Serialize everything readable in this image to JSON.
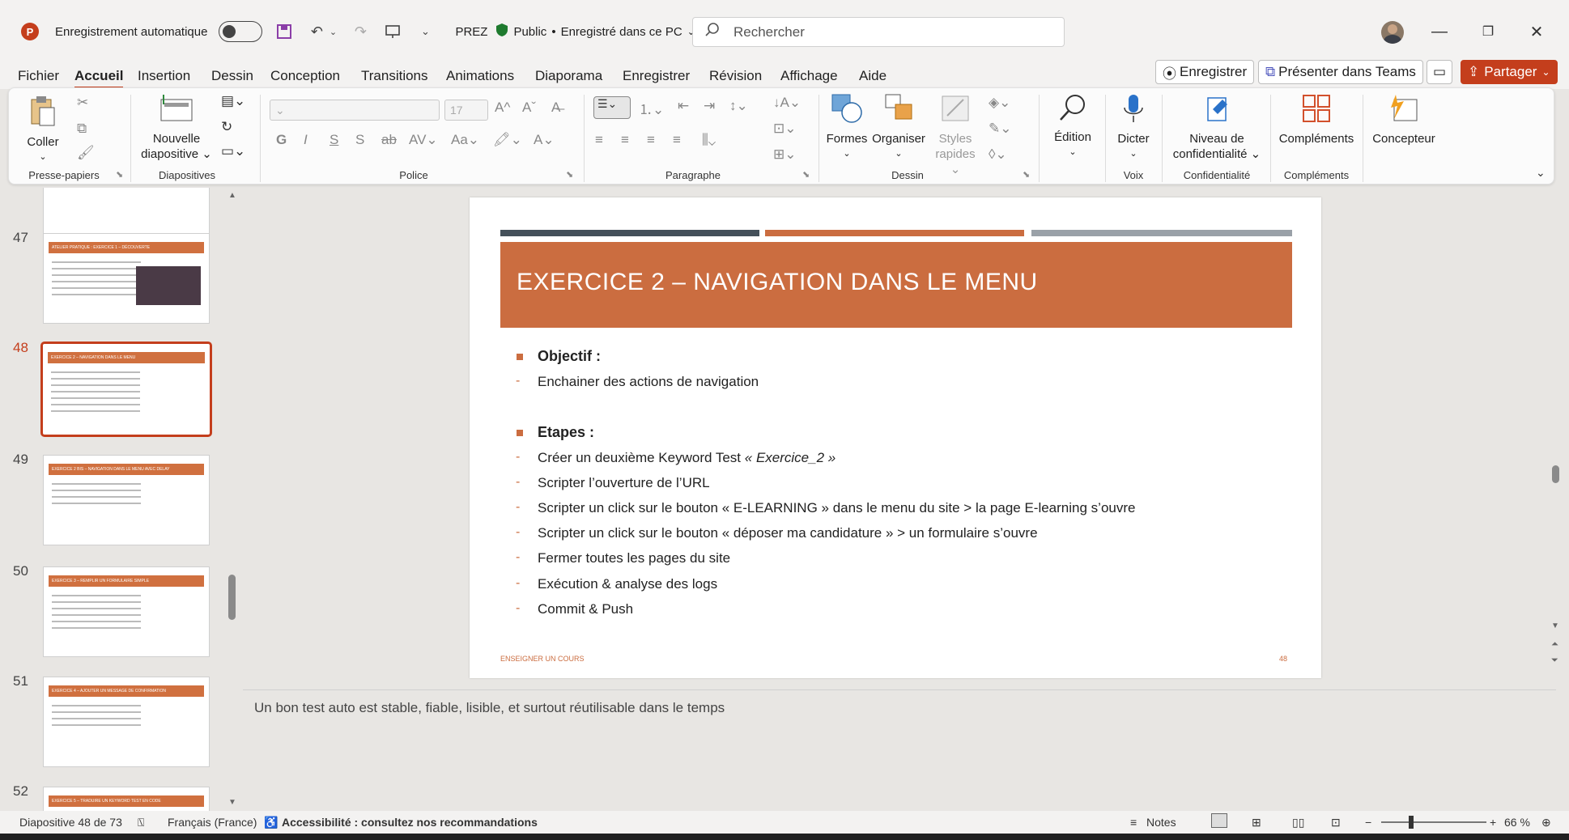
{
  "titlebar": {
    "autosave_label": "Enregistrement automatique",
    "filename": "PREZ",
    "sensitivity": "Public",
    "save_status": "Enregistré dans ce PC",
    "search_placeholder": "Rechercher"
  },
  "menu": {
    "tabs": [
      "Fichier",
      "Accueil",
      "Insertion",
      "Dessin",
      "Conception",
      "Transitions",
      "Animations",
      "Diaporama",
      "Enregistrer",
      "Révision",
      "Affichage",
      "Aide"
    ],
    "active_tab": "Accueil",
    "record_button": "Enregistrer",
    "teams_button": "Présenter dans Teams",
    "share_button": "Partager"
  },
  "ribbon": {
    "clipboard": {
      "paste": "Coller",
      "group": "Presse-papiers"
    },
    "slides": {
      "new_slide_1": "Nouvelle",
      "new_slide_2": "diapositive",
      "group": "Diapositives"
    },
    "font": {
      "size": "17",
      "group": "Police",
      "bold": "G",
      "italic": "I",
      "underline": "S",
      "shadow": "S",
      "strike": "ab"
    },
    "paragraph": {
      "group": "Paragraphe"
    },
    "drawing": {
      "shapes": "Formes",
      "arrange": "Organiser",
      "styles_1": "Styles",
      "styles_2": "rapides",
      "group": "Dessin"
    },
    "editing": {
      "label": "Édition"
    },
    "voice": {
      "dictate": "Dicter",
      "group": "Voix"
    },
    "confidentiality": {
      "label_1": "Niveau de",
      "label_2": "confidentialité",
      "group": "Confidentialité"
    },
    "addins": {
      "label": "Compléments",
      "group": "Compléments"
    },
    "designer": {
      "label": "Concepteur"
    }
  },
  "thumbnails": [
    {
      "num": "47",
      "title": "ATELIER PRATIQUE : EXERCICE 1 – DÉCOUVERTE"
    },
    {
      "num": "48",
      "title": "EXERCICE 2 – NAVIGATION DANS LE MENU"
    },
    {
      "num": "49",
      "title": "EXERCICE 2 BIS – NAVIGATION DANS LE MENU AVEC DELAY"
    },
    {
      "num": "50",
      "title": "EXERCICE 3 – REMPLIR UN FORMULAIRE SIMPLE"
    },
    {
      "num": "51",
      "title": "EXERCICE 4 – AJOUTER UN MESSAGE DE CONFIRMATION"
    },
    {
      "num": "52",
      "title": "EXERCICE 5 – TRADUIRE UN KEYWORD TEST EN CODE"
    }
  ],
  "slide": {
    "title": "EXERCICE 2 – NAVIGATION DANS LE MENU",
    "objective_heading": "Objectif :",
    "objective": "Enchainer des actions de navigation",
    "steps_heading": "Etapes :",
    "step_1_prefix": "Créer un deuxième Keyword Test ",
    "step_1_italic": "« Exercice_2 »",
    "step_2": "Scripter l’ouverture de l’URL",
    "step_3": "Scripter un click sur le bouton « E-LEARNING » dans le menu du site > la page E-learning s’ouvre",
    "step_4": "Scripter un click sur le bouton « déposer ma candidature » > un formulaire s’ouvre",
    "step_5": "Fermer toutes les pages du site",
    "step_6": "Exécution & analyse des logs",
    "step_7": "Commit & Push",
    "footer_left": "ENSEIGNER UN COURS",
    "footer_right": "48",
    "stripe_colors": [
      "#44505a",
      "#cb6d40",
      "#9aa1a8"
    ]
  },
  "notes": {
    "text": "Un bon test auto est stable, fiable, lisible, et surtout réutilisable dans le temps"
  },
  "status": {
    "slide_info": "Diapositive 48 de 73",
    "language": "Français (France)",
    "accessibility": "Accessibilité : consultez nos recommandations",
    "notes_button": "Notes",
    "zoom": "66 %"
  }
}
